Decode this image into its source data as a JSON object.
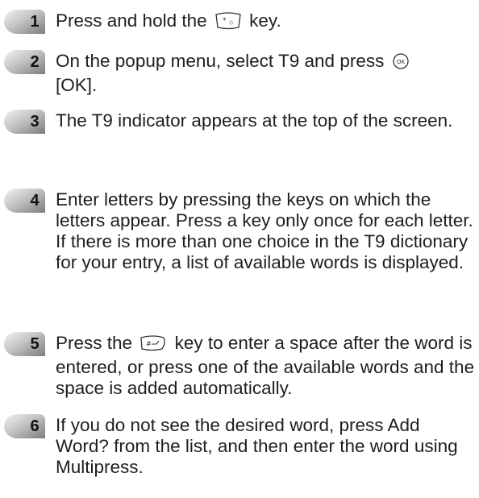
{
  "steps": [
    {
      "number": "1",
      "text_before": "Press and hold the",
      "key_icon": "star-key-icon",
      "text_after": "key."
    },
    {
      "number": "2",
      "text_before": "On the popup menu, select T9 and press",
      "key_icon": "ok-key-icon",
      "text_after": "[OK]."
    },
    {
      "number": "3",
      "text": "The T9 indicator appears at the top of the screen."
    },
    {
      "number": "4",
      "text": "Enter letters by pressing the keys on which the letters appear. Press a key only once for each letter. If there is more than one choice in the T9 dictionary for your entry, a list of available words is displayed."
    },
    {
      "number": "5",
      "text_before": "Press the",
      "key_icon": "pound-key-icon",
      "text_after": "key to enter a space after the word is entered, or press one of the available words and the space is added automatically."
    },
    {
      "number": "6",
      "text": "If you do not see the desired word, press Add Word? from the list, and then enter the word using Multipress."
    }
  ],
  "colors": {
    "badge_gradient_light": "#e6e6e6",
    "badge_gradient_dark": "#8a8a8a",
    "text": "#1e1e1e"
  }
}
